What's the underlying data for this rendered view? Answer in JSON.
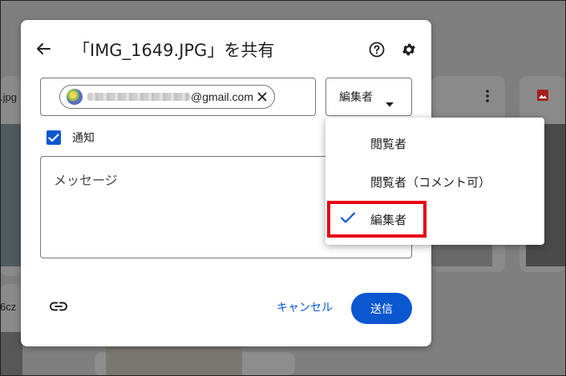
{
  "background": {
    "left_file_name": ".jpg",
    "left_file_name2": "6cz"
  },
  "dialog": {
    "title": "「IMG_1649.JPG」を共有",
    "recipient": {
      "chip_email_suffix": "@gmail.com"
    },
    "role_select": {
      "selected": "編集者"
    },
    "notify": {
      "label": "通知",
      "checked": true
    },
    "message": {
      "placeholder": "メッセージ"
    },
    "buttons": {
      "cancel": "キャンセル",
      "send": "送信"
    }
  },
  "role_menu": {
    "items": [
      {
        "label": "閲覧者",
        "selected": false
      },
      {
        "label": "閲覧者（コメント可）",
        "selected": false
      },
      {
        "label": "編集者",
        "selected": true
      }
    ]
  },
  "colors": {
    "accent": "#0b57d0",
    "highlight": "#e60012"
  },
  "icons": [
    "back-arrow-icon",
    "help-icon",
    "settings-gear-icon",
    "close-icon",
    "dropdown-arrow-icon",
    "checkmark-icon",
    "link-icon",
    "more-vert-icon",
    "image-icon"
  ]
}
